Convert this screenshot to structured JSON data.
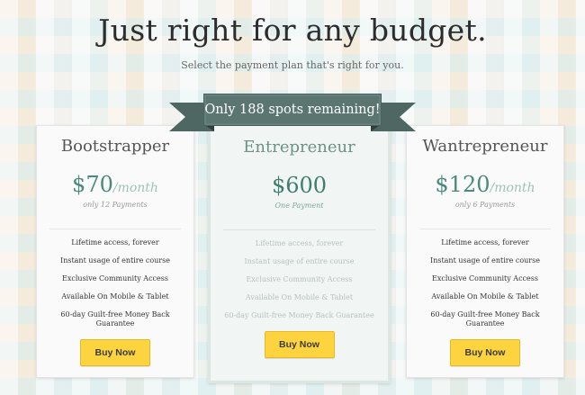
{
  "header": {
    "title": "Just right for any budget.",
    "subtitle": "Select the payment plan that's right for you."
  },
  "ribbon": {
    "text": "Only 188 spots remaining!"
  },
  "plans": [
    {
      "name": "Bootstrapper",
      "price": "$70",
      "period": "/month",
      "payments": "only 12 Payments",
      "features": [
        "Lifetime access, forever",
        "Instant usage of entire course",
        "Exclusive Community Access",
        "Available On Mobile & Tablet",
        "60-day Guilt-free Money Back Guarantee"
      ],
      "button": "Buy Now"
    },
    {
      "name": "Entrepreneur",
      "price": "$600",
      "period": "",
      "payments": "One Payment",
      "features": [
        "Lifetime access, forever",
        "Instant usage of entire course",
        "Exclusive Community Access",
        "Available On Mobile & Tablet",
        "60-day Guilt-free Money Back Guarantee"
      ],
      "button": "Buy Now"
    },
    {
      "name": "Wantrepreneur",
      "price": "$120",
      "period": "/month",
      "payments": "only 6 Payments",
      "features": [
        "Lifetime access, forever",
        "Instant usage of entire course",
        "Exclusive Community Access",
        "Available On Mobile & Tablet",
        "60-day Guilt-free Money Back Guarantee"
      ],
      "button": "Buy Now"
    }
  ],
  "colors": {
    "accent": "#4b8a7b",
    "ribbon": "#5b7671",
    "button": "#fdd43f"
  }
}
